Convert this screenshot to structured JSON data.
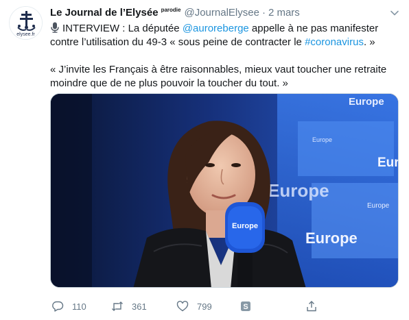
{
  "tweet": {
    "author": {
      "name": "Le Journal de l’Elysée",
      "badge": "parodie",
      "handle": "@JournalElysee",
      "date": "2 mars",
      "avatar_caption": "elysee.fr"
    },
    "body": {
      "line1_prefix": "INTERVIEW : La députée ",
      "mention": "@auroreberge",
      "line1_middle": " appelle à ne pas manifester contre l’utilisation du 49-3 « sous peine de contracter le ",
      "hashtag": "#coronavirus",
      "line1_suffix": ". »",
      "quote": "« J’invite les Français à être raisonnables, mieux vaut toucher une retraite moindre que de ne plus pouvoir la toucher du tout. »"
    },
    "media": {
      "background_labels": [
        "Europe",
        "Europe",
        "Eur",
        "Europe",
        "Europe",
        "Europe"
      ],
      "mic_label": "Europe"
    },
    "actions": {
      "reply_count": "110",
      "retweet_count": "361",
      "like_count": "799"
    }
  },
  "colors": {
    "link": "#1b95e0",
    "text": "#14171a",
    "secondary": "#657786",
    "border": "#e6ecf0"
  },
  "icons": {
    "menu": "chevron-down-icon",
    "mic": "microphone-icon",
    "reply": "reply-icon",
    "retweet": "retweet-icon",
    "like": "heart-icon",
    "sharing": "shareable-s-icon",
    "share": "share-icon"
  }
}
